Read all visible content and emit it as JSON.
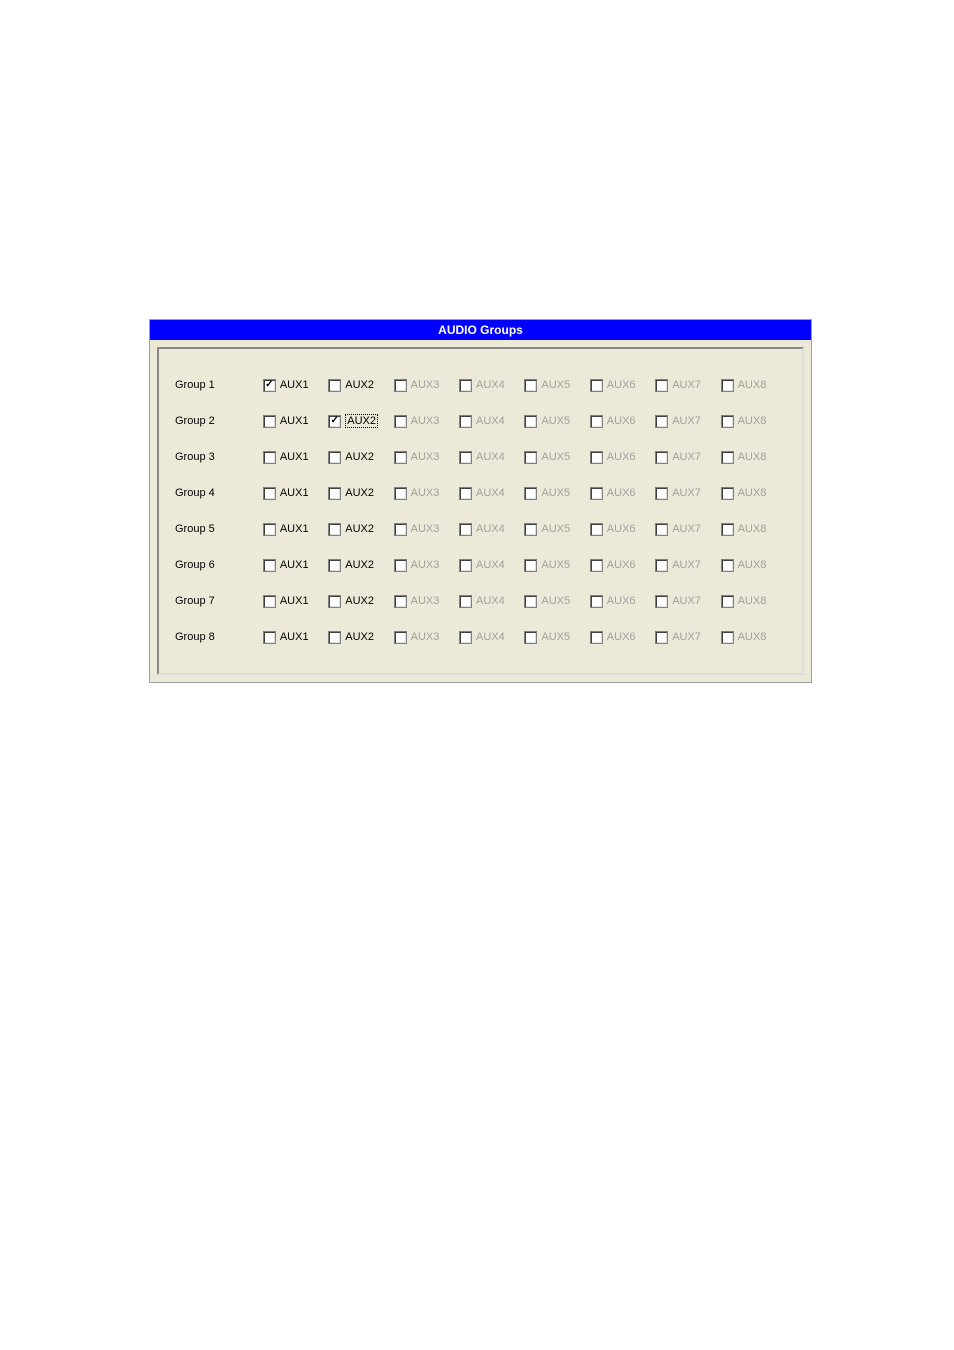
{
  "header_title": "AUDIO Groups",
  "aux_labels": [
    "AUX1",
    "AUX2",
    "AUX3",
    "AUX4",
    "AUX5",
    "AUX6",
    "AUX7",
    "AUX8"
  ],
  "groups": [
    {
      "label": "Group 1",
      "aux": [
        {
          "checked": true,
          "enabled": true,
          "focused": false
        },
        {
          "checked": false,
          "enabled": true,
          "focused": false
        },
        {
          "checked": false,
          "enabled": false,
          "focused": false
        },
        {
          "checked": false,
          "enabled": false,
          "focused": false
        },
        {
          "checked": false,
          "enabled": false,
          "focused": false
        },
        {
          "checked": false,
          "enabled": false,
          "focused": false
        },
        {
          "checked": false,
          "enabled": false,
          "focused": false
        },
        {
          "checked": false,
          "enabled": false,
          "focused": false
        }
      ]
    },
    {
      "label": "Group 2",
      "aux": [
        {
          "checked": false,
          "enabled": true,
          "focused": false
        },
        {
          "checked": true,
          "enabled": true,
          "focused": true
        },
        {
          "checked": false,
          "enabled": false,
          "focused": false
        },
        {
          "checked": false,
          "enabled": false,
          "focused": false
        },
        {
          "checked": false,
          "enabled": false,
          "focused": false
        },
        {
          "checked": false,
          "enabled": false,
          "focused": false
        },
        {
          "checked": false,
          "enabled": false,
          "focused": false
        },
        {
          "checked": false,
          "enabled": false,
          "focused": false
        }
      ]
    },
    {
      "label": "Group 3",
      "aux": [
        {
          "checked": false,
          "enabled": true,
          "focused": false
        },
        {
          "checked": false,
          "enabled": true,
          "focused": false
        },
        {
          "checked": false,
          "enabled": false,
          "focused": false
        },
        {
          "checked": false,
          "enabled": false,
          "focused": false
        },
        {
          "checked": false,
          "enabled": false,
          "focused": false
        },
        {
          "checked": false,
          "enabled": false,
          "focused": false
        },
        {
          "checked": false,
          "enabled": false,
          "focused": false
        },
        {
          "checked": false,
          "enabled": false,
          "focused": false
        }
      ]
    },
    {
      "label": "Group 4",
      "aux": [
        {
          "checked": false,
          "enabled": true,
          "focused": false
        },
        {
          "checked": false,
          "enabled": true,
          "focused": false
        },
        {
          "checked": false,
          "enabled": false,
          "focused": false
        },
        {
          "checked": false,
          "enabled": false,
          "focused": false
        },
        {
          "checked": false,
          "enabled": false,
          "focused": false
        },
        {
          "checked": false,
          "enabled": false,
          "focused": false
        },
        {
          "checked": false,
          "enabled": false,
          "focused": false
        },
        {
          "checked": false,
          "enabled": false,
          "focused": false
        }
      ]
    },
    {
      "label": "Group 5",
      "aux": [
        {
          "checked": false,
          "enabled": true,
          "focused": false
        },
        {
          "checked": false,
          "enabled": true,
          "focused": false
        },
        {
          "checked": false,
          "enabled": false,
          "focused": false
        },
        {
          "checked": false,
          "enabled": false,
          "focused": false
        },
        {
          "checked": false,
          "enabled": false,
          "focused": false
        },
        {
          "checked": false,
          "enabled": false,
          "focused": false
        },
        {
          "checked": false,
          "enabled": false,
          "focused": false
        },
        {
          "checked": false,
          "enabled": false,
          "focused": false
        }
      ]
    },
    {
      "label": "Group 6",
      "aux": [
        {
          "checked": false,
          "enabled": true,
          "focused": false
        },
        {
          "checked": false,
          "enabled": true,
          "focused": false
        },
        {
          "checked": false,
          "enabled": false,
          "focused": false
        },
        {
          "checked": false,
          "enabled": false,
          "focused": false
        },
        {
          "checked": false,
          "enabled": false,
          "focused": false
        },
        {
          "checked": false,
          "enabled": false,
          "focused": false
        },
        {
          "checked": false,
          "enabled": false,
          "focused": false
        },
        {
          "checked": false,
          "enabled": false,
          "focused": false
        }
      ]
    },
    {
      "label": "Group 7",
      "aux": [
        {
          "checked": false,
          "enabled": true,
          "focused": false
        },
        {
          "checked": false,
          "enabled": true,
          "focused": false
        },
        {
          "checked": false,
          "enabled": false,
          "focused": false
        },
        {
          "checked": false,
          "enabled": false,
          "focused": false
        },
        {
          "checked": false,
          "enabled": false,
          "focused": false
        },
        {
          "checked": false,
          "enabled": false,
          "focused": false
        },
        {
          "checked": false,
          "enabled": false,
          "focused": false
        },
        {
          "checked": false,
          "enabled": false,
          "focused": false
        }
      ]
    },
    {
      "label": "Group 8",
      "aux": [
        {
          "checked": false,
          "enabled": true,
          "focused": false
        },
        {
          "checked": false,
          "enabled": true,
          "focused": false
        },
        {
          "checked": false,
          "enabled": false,
          "focused": false
        },
        {
          "checked": false,
          "enabled": false,
          "focused": false
        },
        {
          "checked": false,
          "enabled": false,
          "focused": false
        },
        {
          "checked": false,
          "enabled": false,
          "focused": false
        },
        {
          "checked": false,
          "enabled": false,
          "focused": false
        },
        {
          "checked": false,
          "enabled": false,
          "focused": false
        }
      ]
    }
  ]
}
